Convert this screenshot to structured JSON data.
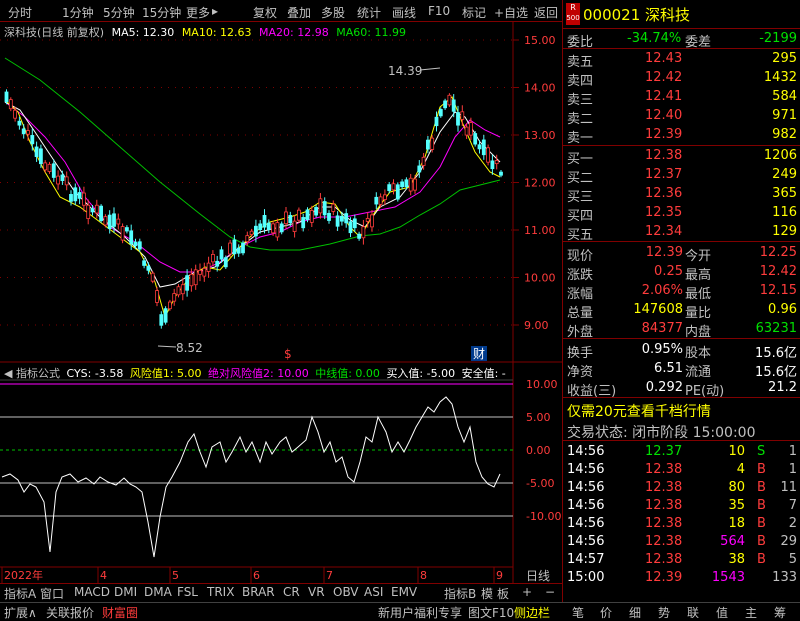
{
  "toolbar": {
    "left_items": [
      "分时",
      "1分钟",
      "5分钟",
      "15分钟",
      "更多"
    ],
    "right_items": [
      "复权",
      "叠加",
      "多股",
      "统计",
      "画线",
      "F10",
      "标记",
      "+自选",
      "返回"
    ],
    "more_arrow": "▸"
  },
  "main_chart": {
    "title": "深科技(日线 前复权)",
    "ma_labels": [
      "MA5: 12.30",
      "MA10: 12.63",
      "MA20: 12.98",
      "MA60: 11.99"
    ],
    "y_ticks": [
      "15.00",
      "14.00",
      "13.00",
      "12.00",
      "11.00",
      "10.00",
      "9.00"
    ],
    "high_label": "14.39",
    "low_label": "8.52",
    "event_marks": [
      "$",
      "财"
    ]
  },
  "indicator": {
    "name": "指标公式",
    "values": [
      "CYS: -3.58",
      "风险值1: 5.00",
      "绝对风险值2: 10.00",
      "中线值: 0.00",
      "买入值: -5.00",
      "安全值: -"
    ],
    "y_ticks": [
      "10.00",
      "5.00",
      "0.00",
      "-5.00",
      "-10.00"
    ]
  },
  "x_axis": {
    "labels": [
      "2022年",
      "4",
      "5",
      "6",
      "7",
      "8",
      "9"
    ],
    "period": "日线"
  },
  "tabs": [
    "指标A",
    "窗口",
    "MACD",
    "DMI",
    "DMA",
    "FSL",
    "TRIX",
    "BRAR",
    "CR",
    "VR",
    "OBV",
    "ASI",
    "EMV",
    "指标B",
    "模",
    "板",
    "+",
    "−"
  ],
  "bottom_bar": {
    "left": [
      "扩展∧",
      "关联报价",
      "财富圈"
    ],
    "right": [
      "新用户福利专享",
      "图文F10",
      "侧边栏"
    ],
    "right_tabs": [
      "笔",
      "价",
      "细",
      "势",
      "联",
      "值",
      "主",
      "筹"
    ]
  },
  "quote": {
    "badge_top": "R",
    "badge_bottom": "500",
    "code": "000021",
    "name": "深科技",
    "weibi_label": "委比",
    "weibi": "-34.74%",
    "weicha_label": "委差",
    "weicha": "-2199",
    "asks": [
      {
        "label": "卖五",
        "price": "12.43",
        "vol": "295"
      },
      {
        "label": "卖四",
        "price": "12.42",
        "vol": "1432"
      },
      {
        "label": "卖三",
        "price": "12.41",
        "vol": "584"
      },
      {
        "label": "卖二",
        "price": "12.40",
        "vol": "971"
      },
      {
        "label": "卖一",
        "price": "12.39",
        "vol": "982"
      }
    ],
    "bids": [
      {
        "label": "买一",
        "price": "12.38",
        "vol": "1206"
      },
      {
        "label": "买二",
        "price": "12.37",
        "vol": "249"
      },
      {
        "label": "买三",
        "price": "12.36",
        "vol": "365"
      },
      {
        "label": "买四",
        "price": "12.35",
        "vol": "116"
      },
      {
        "label": "买五",
        "price": "12.34",
        "vol": "129"
      }
    ],
    "stats": [
      {
        "l1": "现价",
        "v1": "12.39",
        "l2": "今开",
        "v2": "12.25"
      },
      {
        "l1": "涨跌",
        "v1": "0.25",
        "l2": "最高",
        "v2": "12.42"
      },
      {
        "l1": "涨幅",
        "v1": "2.06%",
        "l2": "最低",
        "v2": "12.15"
      },
      {
        "l1": "总量",
        "v1": "147608",
        "l2": "量比",
        "v2": "0.96"
      },
      {
        "l1": "外盘",
        "v1": "84377",
        "l2": "内盘",
        "v2": "63231"
      }
    ],
    "stats2": [
      {
        "l1": "换手",
        "v1": "0.95%",
        "l2": "股本",
        "v2": "15.6亿"
      },
      {
        "l1": "净资",
        "v1": "6.51",
        "l2": "流通",
        "v2": "15.6亿"
      },
      {
        "l1": "收益(三)",
        "v1": "0.292",
        "l2": "PE(动)",
        "v2": "21.2"
      }
    ],
    "promo": "仅需20元查看千档行情",
    "trade_status": "交易状态: 闭市阶段 15:00:00",
    "ticks": [
      {
        "t": "14:56",
        "p": "12.37",
        "v": "10",
        "s": "S",
        "n": "1"
      },
      {
        "t": "14:56",
        "p": "12.38",
        "v": "4",
        "s": "B",
        "n": "1"
      },
      {
        "t": "14:56",
        "p": "12.38",
        "v": "80",
        "s": "B",
        "n": "11"
      },
      {
        "t": "14:56",
        "p": "12.38",
        "v": "35",
        "s": "B",
        "n": "7"
      },
      {
        "t": "14:56",
        "p": "12.38",
        "v": "18",
        "s": "B",
        "n": "2"
      },
      {
        "t": "14:56",
        "p": "12.38",
        "v": "564",
        "s": "B",
        "n": "29"
      },
      {
        "t": "14:57",
        "p": "12.38",
        "v": "38",
        "s": "B",
        "n": "5"
      },
      {
        "t": "15:00",
        "p": "12.39",
        "v": "1543",
        "s": "",
        "n": "133"
      }
    ]
  }
}
